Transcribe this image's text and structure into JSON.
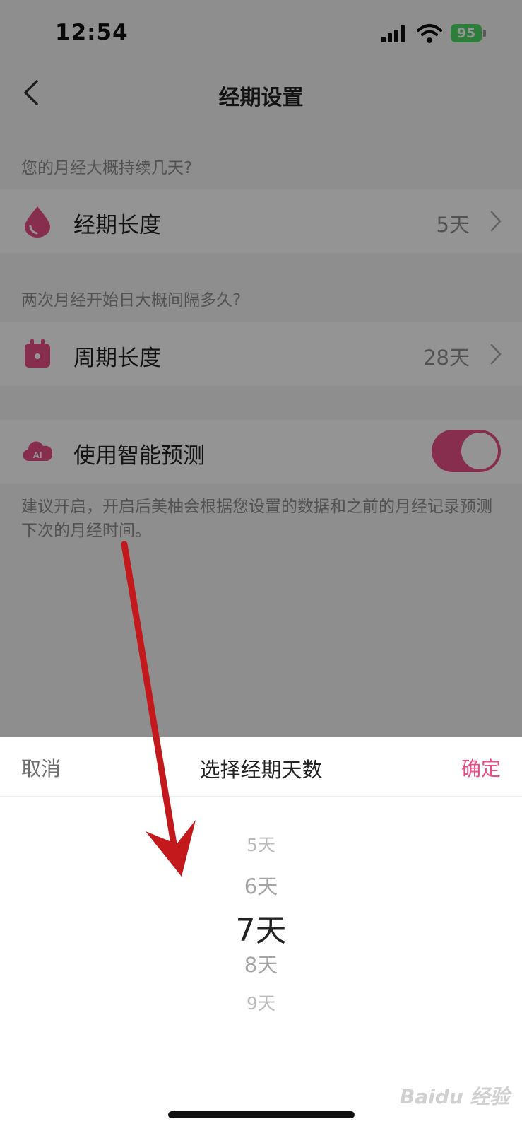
{
  "status_bar": {
    "time": "12:54",
    "battery": "95"
  },
  "nav": {
    "title": "经期设置"
  },
  "sections": {
    "period_question": "您的月经大概持续几天?",
    "cycle_question": "两次月经开始日大概间隔多久?"
  },
  "rows": {
    "period_length": {
      "label": "经期长度",
      "value": "5天"
    },
    "cycle_length": {
      "label": "周期长度",
      "value": "28天"
    },
    "smart_prediction": {
      "label": "使用智能预测",
      "enabled": true,
      "icon_text": "AI"
    }
  },
  "hint": "建议开启，开启后美柚会根据您设置的数据和之前的月经记录预测下次的月经时间。",
  "sheet": {
    "cancel": "取消",
    "title": "选择经期天数",
    "confirm": "确定",
    "options": [
      "5天",
      "6天",
      "7天",
      "8天",
      "9天"
    ],
    "selected_index": 2
  },
  "watermark": "Baidu 经验",
  "colors": {
    "accent": "#e84e86",
    "annotation_arrow": "#c4191c",
    "battery": "#4cd964"
  }
}
